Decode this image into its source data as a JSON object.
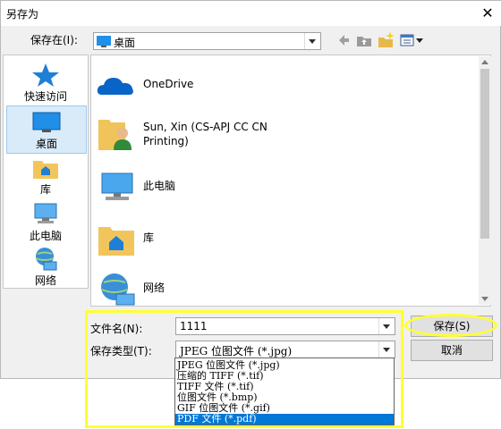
{
  "window": {
    "title": "另存为",
    "close_glyph": "✕"
  },
  "save_in": {
    "label": "保存在(I):",
    "value": "桌面"
  },
  "places": [
    {
      "label": "快速访问"
    },
    {
      "label": "桌面"
    },
    {
      "label": "库"
    },
    {
      "label": "此电脑"
    },
    {
      "label": "网络"
    }
  ],
  "items": [
    {
      "label": "OneDrive"
    },
    {
      "label": "Sun, Xin (CS-APJ CC CN",
      "label2": "Printing)"
    },
    {
      "label": "此电脑"
    },
    {
      "label": "库"
    },
    {
      "label": "网络"
    }
  ],
  "file_name": {
    "label": "文件名(N):",
    "value": "1111"
  },
  "file_type": {
    "label": "保存类型(T):",
    "value": "JPEG 位图文件  (*.jpg)",
    "options": [
      "JPEG 位图文件  (*.jpg)",
      "压缩的 TIFF (*.tif)",
      "TIFF 文件  (*.tif)",
      "位图文件  (*.bmp)",
      "GIF 位图文件 (*.gif)",
      "PDF 文件  (*.pdf)"
    ]
  },
  "buttons": {
    "save": "保存(S)",
    "cancel": "取消"
  },
  "colors": {
    "highlight": "#ffff33",
    "selection": "#0078d7"
  }
}
